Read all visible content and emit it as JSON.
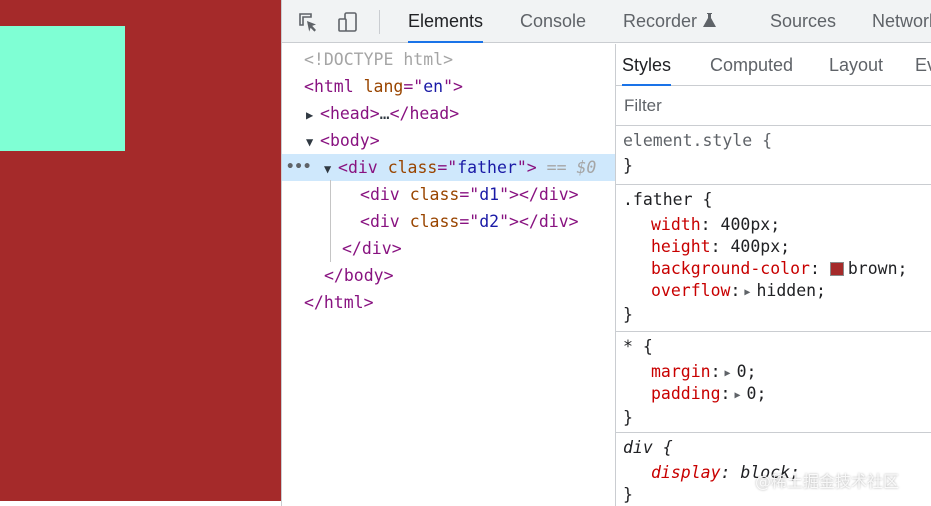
{
  "colors": {
    "father_background": "#a52a2a",
    "d1_background": "#7fffd4",
    "active_tab_underline": "#1a73e8",
    "selected_row": "#cfe8fc"
  },
  "toolbar": {
    "icons": [
      "inspect-element-icon",
      "device-toolbar-icon"
    ],
    "tabs": [
      {
        "label": "Elements",
        "active": true
      },
      {
        "label": "Console",
        "active": false
      },
      {
        "label": "Recorder",
        "active": false,
        "icon": "flask-icon"
      },
      {
        "label": "Sources",
        "active": false
      },
      {
        "label": "Network",
        "active": false
      }
    ]
  },
  "dom_tree": {
    "doctype": "<!DOCTYPE html>",
    "html_open_tag": "html",
    "html_attr_name": "lang",
    "html_attr_value": "en",
    "head_tag": "head",
    "head_ellipsis": "…",
    "body_tag": "body",
    "father_tag": "div",
    "father_attr_name": "class",
    "father_attr_value": "father",
    "selected_marker": "== $0",
    "child1_tag": "div",
    "child1_attr_name": "class",
    "child1_attr_value": "d1",
    "child2_tag": "div",
    "child2_attr_name": "class",
    "child2_attr_value": "d2",
    "close_div": "div",
    "close_body": "body",
    "close_html": "html",
    "row_dots": "•••"
  },
  "styles_pane": {
    "sub_tabs": [
      {
        "label": "Styles",
        "active": true
      },
      {
        "label": "Computed",
        "active": false
      },
      {
        "label": "Layout",
        "active": false
      },
      {
        "label": "Ev",
        "active": false
      }
    ],
    "filter_placeholder": "Filter",
    "rules": {
      "element_style": {
        "selector": "element.style {",
        "close": "}"
      },
      "father": {
        "selector": ".father {",
        "props": [
          {
            "name": "width",
            "value": "400px;"
          },
          {
            "name": "height",
            "value": "400px;"
          },
          {
            "name": "background-color",
            "value": "brown;"
          },
          {
            "name": "overflow",
            "value": "hidden;"
          }
        ],
        "close": "}"
      },
      "universal": {
        "selector": "* {",
        "props": [
          {
            "name": "margin",
            "value": "0;"
          },
          {
            "name": "padding",
            "value": "0;"
          }
        ],
        "close": "}"
      },
      "div_ua": {
        "selector": "div {",
        "props": [
          {
            "name": "display",
            "value": "block;"
          }
        ],
        "close": "}"
      }
    }
  },
  "watermark": "@稀土掘金技术社区"
}
